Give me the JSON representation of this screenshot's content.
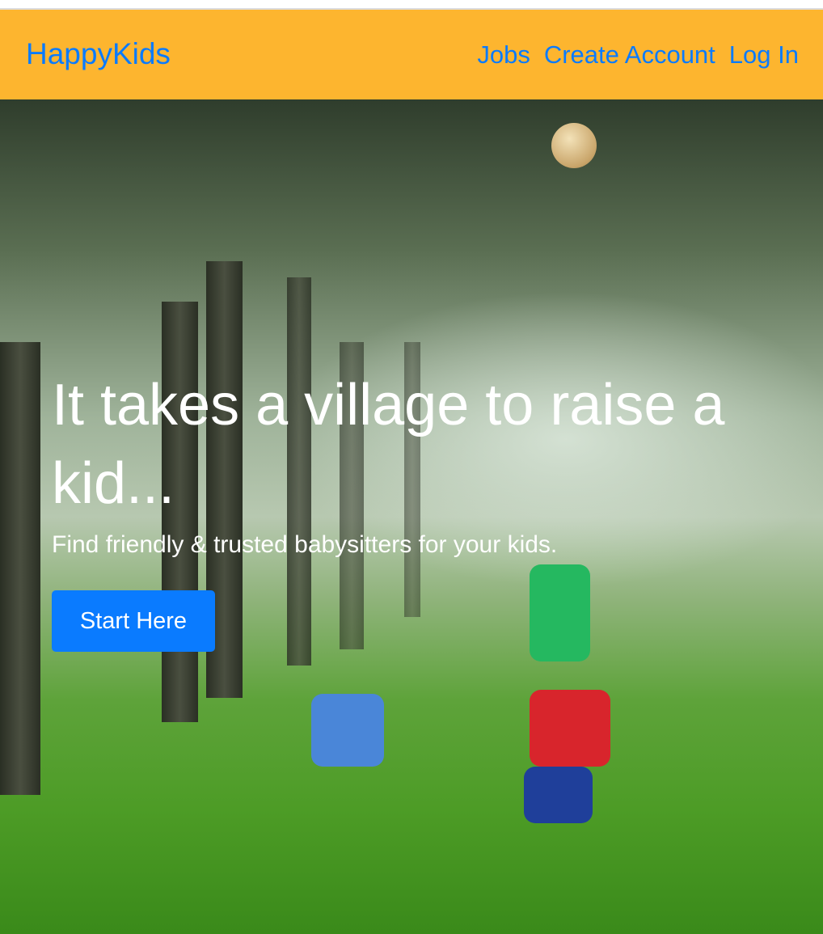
{
  "navbar": {
    "brand": "HappyKids",
    "links": [
      {
        "label": "Jobs"
      },
      {
        "label": "Create Account"
      },
      {
        "label": "Log In"
      }
    ],
    "background_color": "#fdb52f",
    "link_color": "#0a7bff"
  },
  "hero": {
    "heading": "It takes a village to raise a kid...",
    "subtitle": "Find friendly & trusted babysitters for your kids.",
    "cta_label": "Start Here",
    "cta_color": "#0a7bff"
  }
}
